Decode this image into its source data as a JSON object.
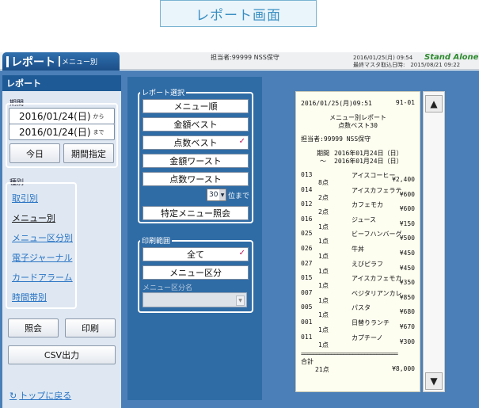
{
  "caption": "レポート画面",
  "header": {
    "tab_title": "レポート",
    "tab_subtitle": "メニュー別",
    "staff": "担当者:99999 NSS保守",
    "datetime": "2016/01/25(月) 09:54",
    "master_fetch": "最終マスタ取込日時:　2015/08/21 09:22",
    "mode": "Stand Alone"
  },
  "left": {
    "title": "レポート",
    "period_label": "期間",
    "date_from": "2016/01/24(日)",
    "date_from_suffix": "から",
    "date_to": "2016/01/24(日)",
    "date_to_suffix": "まで",
    "today_button": "今日",
    "period_button": "期間指定",
    "kind_label": "種別",
    "kinds": [
      "取引別",
      "メニュー別",
      "メニュー区分別",
      "電子ジャーナル",
      "カードアラーム",
      "時間帯別"
    ],
    "inquiry_button": "照会",
    "print_button": "印刷",
    "csv_button": "CSV出力",
    "back_link": "トップに戻る"
  },
  "middle": {
    "select_label": "レポート選択",
    "report_buttons": [
      "メニュー順",
      "金額ベスト",
      "点数ベスト",
      "金額ワースト",
      "点数ワースト"
    ],
    "rank_value": "30",
    "rank_suffix": "位まで",
    "special_button": "特定メニュー照会",
    "print_range_label": "印刷範囲",
    "range_buttons": [
      "全て",
      "メニュー区分"
    ],
    "category_name_label": "メニュー区分名"
  },
  "receipt": {
    "datetime": "2016/01/25(月)09:51",
    "terminal": "91-01",
    "title1": "メニュー別レポート",
    "title2": "点数ベスト30",
    "staff": "担当者:99999 NSS保守",
    "period_label": "期間",
    "period_from": "2016年01月24日（日）",
    "period_tilde": "～",
    "period_to": "2016年01月24日（日）",
    "items": [
      {
        "code": "013",
        "name": "アイスコーヒー",
        "qty": "8点",
        "amount": "¥2,400"
      },
      {
        "code": "014",
        "name": "アイスカフェラテ",
        "qty": "2点",
        "amount": "¥600"
      },
      {
        "code": "012",
        "name": "カフェモカ",
        "qty": "2点",
        "amount": "¥600"
      },
      {
        "code": "016",
        "name": "ジュース",
        "qty": "1点",
        "amount": "¥150"
      },
      {
        "code": "025",
        "name": "ビーフハンバーグ",
        "qty": "1点",
        "amount": "¥500"
      },
      {
        "code": "026",
        "name": "牛丼",
        "qty": "1点",
        "amount": "¥450"
      },
      {
        "code": "027",
        "name": "えびピラフ",
        "qty": "1点",
        "amount": "¥450"
      },
      {
        "code": "015",
        "name": "アイスカフェモカ",
        "qty": "1点",
        "amount": "¥350"
      },
      {
        "code": "007",
        "name": "ベジタリアンカレ",
        "qty": "1点",
        "amount": "¥850"
      },
      {
        "code": "005",
        "name": "パスタ",
        "qty": "1点",
        "amount": "¥680"
      },
      {
        "code": "001",
        "name": "日替りランチ",
        "qty": "1点",
        "amount": "¥670"
      },
      {
        "code": "011",
        "name": "カプチーノ",
        "qty": "1点",
        "amount": "¥300"
      }
    ],
    "separator": "================================",
    "total_label": "合計",
    "total_qty": "21点",
    "total_amount": "¥8,000"
  },
  "icons": {
    "scroll_up": "▲",
    "scroll_down": "▼",
    "back_icon": "↻",
    "check": "✓",
    "dropdown": "▼"
  }
}
